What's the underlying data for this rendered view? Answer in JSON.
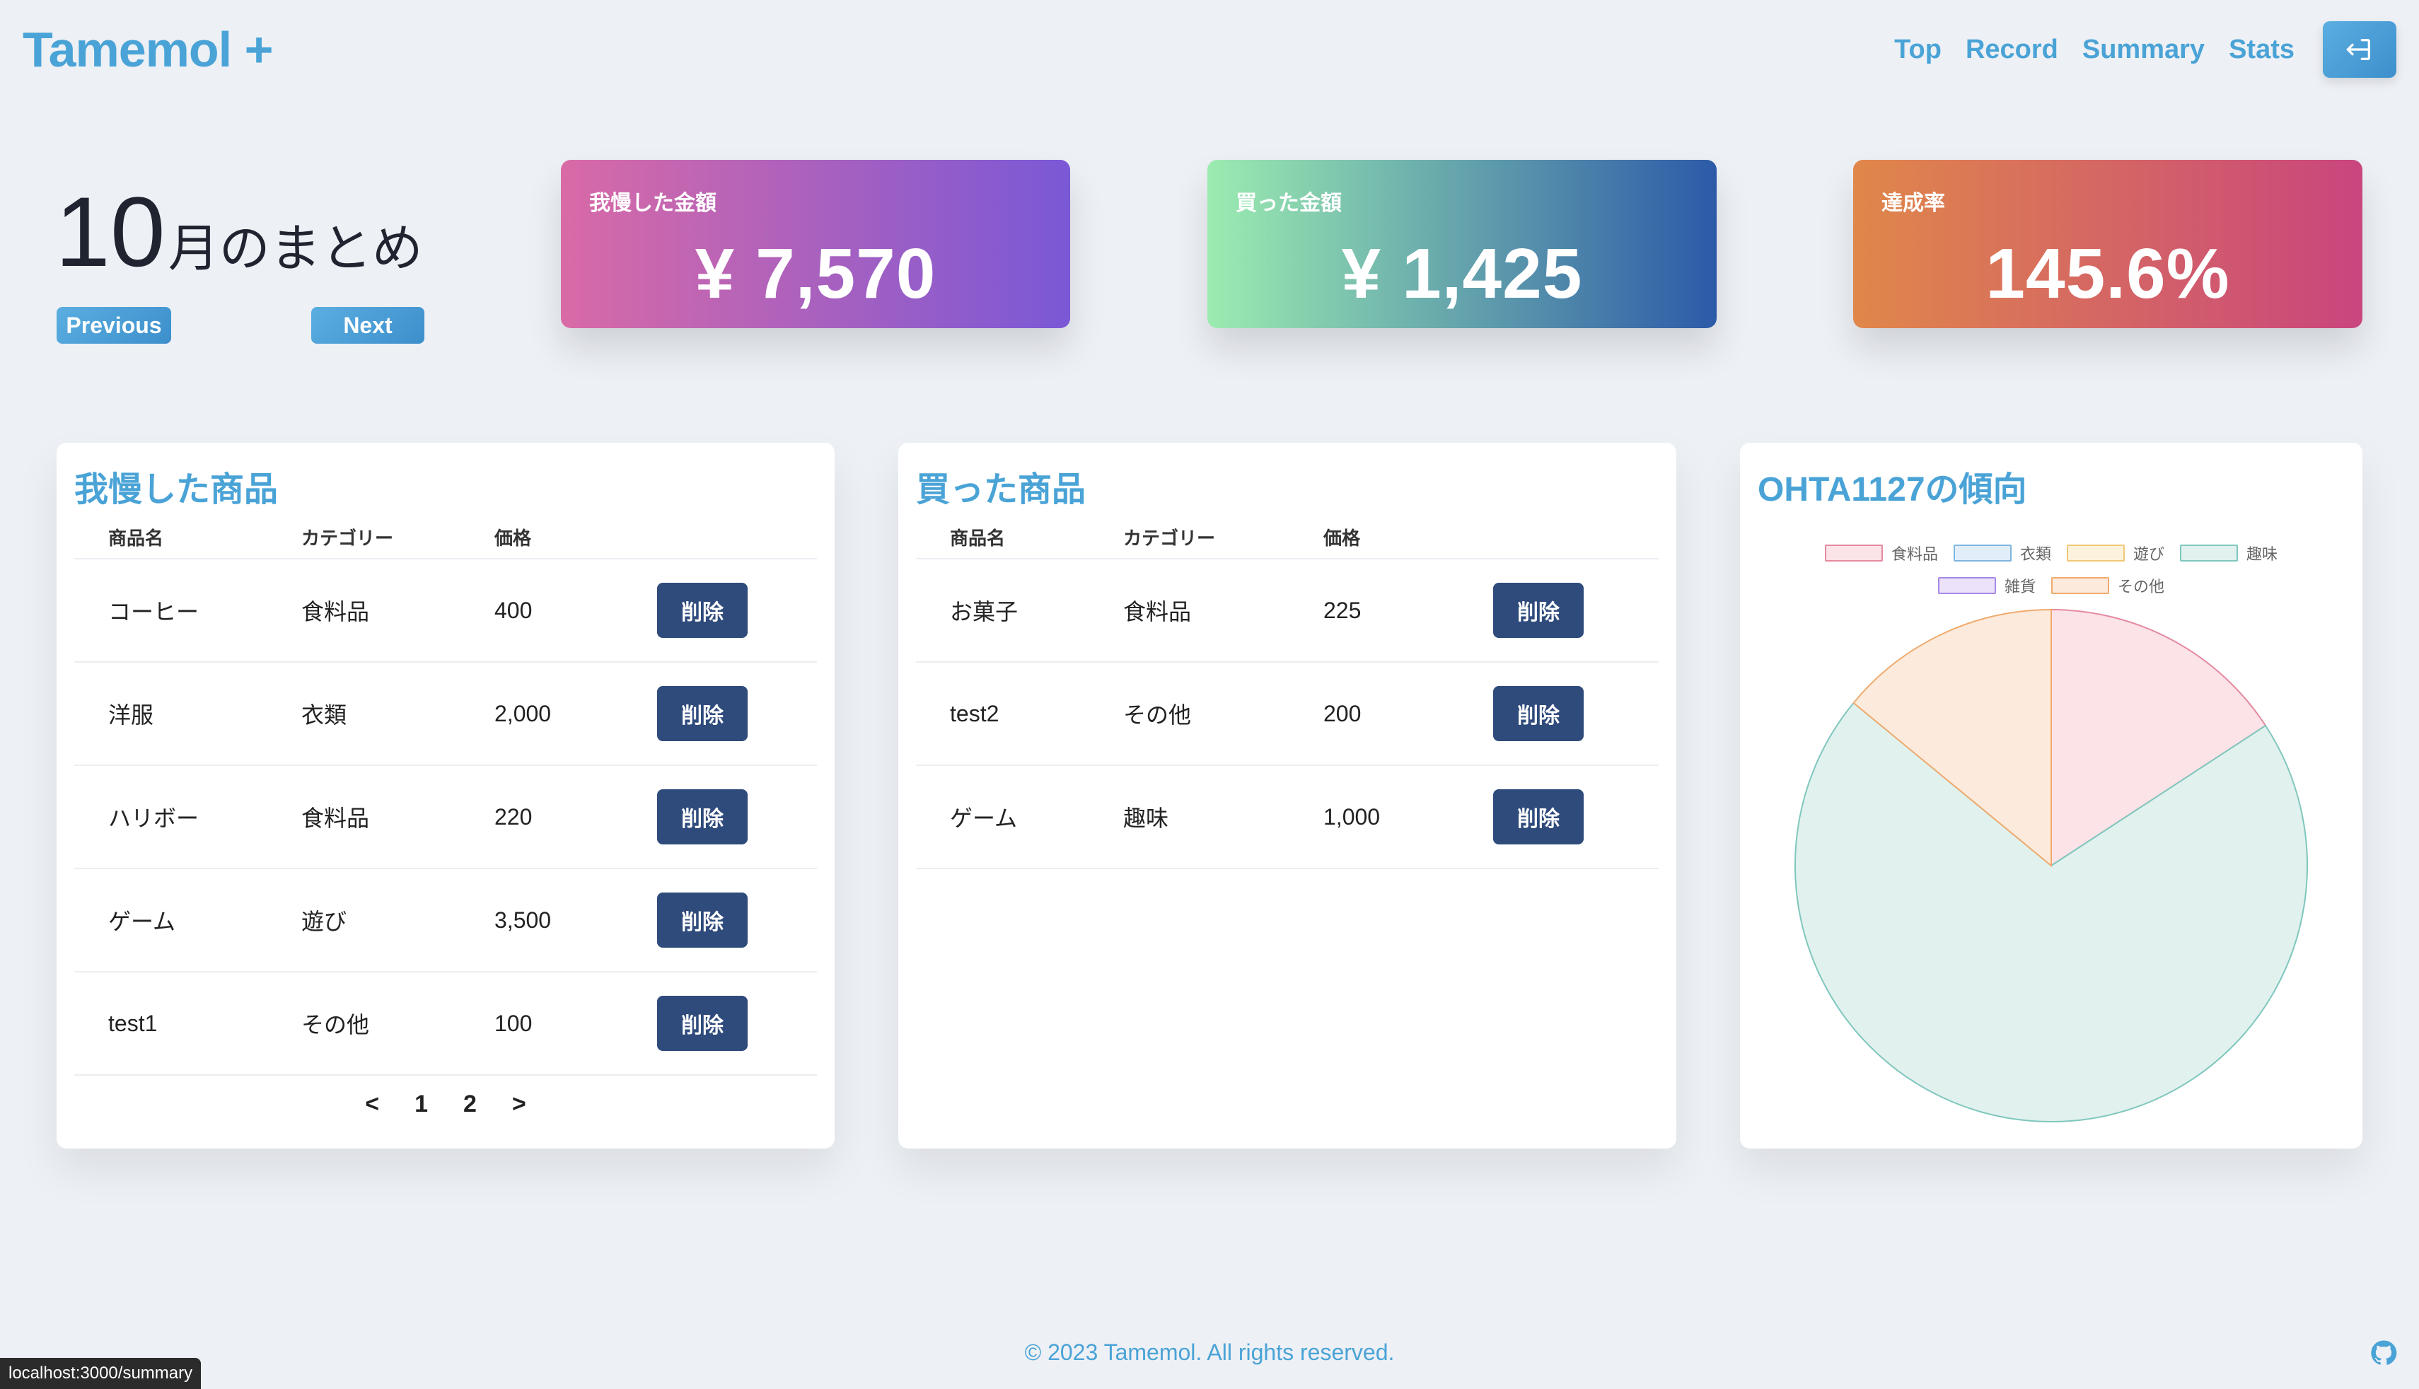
{
  "app": {
    "logo": "Tamemol +"
  },
  "nav": {
    "top": "Top",
    "record": "Record",
    "summary": "Summary",
    "stats": "Stats",
    "logout_icon": "logout-icon"
  },
  "month": {
    "number": "10",
    "suffix": "月のまとめ",
    "prev_label": "Previous",
    "next_label": "Next"
  },
  "stats": {
    "saved_label": "我慢した金額",
    "saved_value": "¥ 7,570",
    "bought_label": "買った金額",
    "bought_value": "¥ 1,425",
    "rate_label": "達成率",
    "rate_value": "145.6%"
  },
  "saved_items": {
    "title": "我慢した商品",
    "headers": [
      "商品名",
      "カテゴリー",
      "価格"
    ],
    "delete_label": "削除",
    "rows": [
      {
        "name": "コーヒー",
        "category": "食料品",
        "price": "400"
      },
      {
        "name": "洋服",
        "category": "衣類",
        "price": "2,000"
      },
      {
        "name": "ハリボー",
        "category": "食料品",
        "price": "220"
      },
      {
        "name": "ゲーム",
        "category": "遊び",
        "price": "3,500"
      },
      {
        "name": "test1",
        "category": "その他",
        "price": "100"
      }
    ],
    "pagination": {
      "prev": "<",
      "pages": [
        "1",
        "2"
      ],
      "next": ">"
    }
  },
  "bought_items": {
    "title": "買った商品",
    "headers": [
      "商品名",
      "カテゴリー",
      "価格"
    ],
    "delete_label": "削除",
    "rows": [
      {
        "name": "お菓子",
        "category": "食料品",
        "price": "225"
      },
      {
        "name": "test2",
        "category": "その他",
        "price": "200"
      },
      {
        "name": "ゲーム",
        "category": "趣味",
        "price": "1,000"
      }
    ]
  },
  "trend": {
    "title": "OHTA1127の傾向",
    "chart_data": {
      "type": "pie",
      "labels": [
        "食料品",
        "衣類",
        "遊び",
        "趣味",
        "雑貨",
        "その他"
      ],
      "values": [
        225,
        0,
        0,
        1000,
        0,
        200
      ],
      "colors_fill": [
        "#fbe3e8",
        "#e1eef9",
        "#fdf2dc",
        "#e1f1ee",
        "#ece3fb",
        "#fcebdc"
      ],
      "colors_border": [
        "#e58aa0",
        "#7fb6e0",
        "#f0c876",
        "#7fc7bd",
        "#a88ae8",
        "#f0aa6e"
      ]
    }
  },
  "footer": {
    "copyright": "© 2023 Tamemol. All rights reserved.",
    "status_url": "localhost:3000/summary"
  }
}
